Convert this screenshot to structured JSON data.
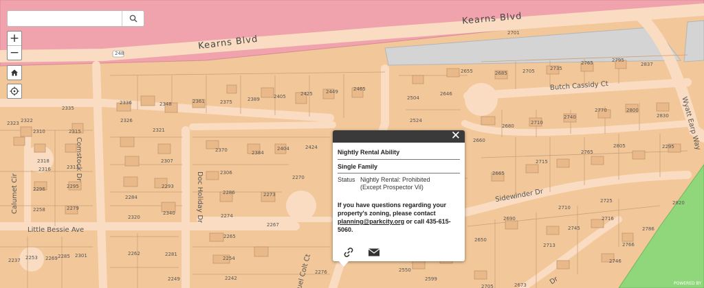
{
  "search": {
    "value": "",
    "placeholder": ""
  },
  "controls": {
    "zoom_in": "+",
    "zoom_out": "−"
  },
  "icons": {
    "search": "search-icon",
    "home": "home-icon",
    "locate": "locate-icon",
    "close": "close-icon",
    "link": "link-icon",
    "email": "envelope-icon"
  },
  "colors": {
    "residential": "#f2c79a",
    "commercial_pink": "#f0a3ad",
    "road": "#f9dcc2",
    "parking_gray": "#d4d4d4",
    "open_space_green": "#8fd77a"
  },
  "streets": {
    "kearns_west": "Kearns Blvd",
    "kearns_east": "Kearns Blvd",
    "comstock": "Comstock Dr",
    "doc_holiday": "Doc Holiday Dr",
    "calumet": "Calumet Cir",
    "little_bessie": "Little Bessie Ave",
    "butch_cassidy": "Butch Cassidy Ct",
    "wyatt_earp": "Wyatt Earp Way",
    "sidewinder": "Sidewinder Dr",
    "sidewinder_dr": "Dr",
    "samuel_colt": "uel Colt Ct",
    "route": "248"
  },
  "parcels": [
    {
      "id": "p1",
      "label": "2701"
    },
    {
      "id": "p2",
      "label": "2655"
    },
    {
      "id": "p3",
      "label": "2685"
    },
    {
      "id": "p4",
      "label": "2705"
    },
    {
      "id": "p5",
      "label": "2735"
    },
    {
      "id": "p6",
      "label": "2765"
    },
    {
      "id": "p7",
      "label": "2795"
    },
    {
      "id": "p8",
      "label": "2837"
    },
    {
      "id": "p9",
      "label": "2336"
    },
    {
      "id": "p10",
      "label": "2348"
    },
    {
      "id": "p11",
      "label": "2361"
    },
    {
      "id": "p12",
      "label": "2375"
    },
    {
      "id": "p13",
      "label": "2389"
    },
    {
      "id": "p14",
      "label": "2405"
    },
    {
      "id": "p15",
      "label": "2425"
    },
    {
      "id": "p16",
      "label": "2449"
    },
    {
      "id": "p17",
      "label": "2465"
    },
    {
      "id": "p18",
      "label": "2335"
    },
    {
      "id": "p19",
      "label": "2323"
    },
    {
      "id": "p20",
      "label": "2322"
    },
    {
      "id": "p21",
      "label": "2326"
    },
    {
      "id": "p22",
      "label": "2310"
    },
    {
      "id": "p23",
      "label": "2321"
    },
    {
      "id": "p24",
      "label": "2315"
    },
    {
      "id": "p25",
      "label": "2318"
    },
    {
      "id": "p26",
      "label": "2316"
    },
    {
      "id": "p27",
      "label": "2313"
    },
    {
      "id": "p28",
      "label": "2307"
    },
    {
      "id": "p29",
      "label": "2296"
    },
    {
      "id": "p30",
      "label": "2295"
    },
    {
      "id": "p31",
      "label": "2284"
    },
    {
      "id": "p32",
      "label": "2293"
    },
    {
      "id": "p33",
      "label": "2258"
    },
    {
      "id": "p34",
      "label": "2279"
    },
    {
      "id": "p35",
      "label": "2320"
    },
    {
      "id": "p36",
      "label": "2340"
    },
    {
      "id": "p37",
      "label": "2370"
    },
    {
      "id": "p38",
      "label": "2384"
    },
    {
      "id": "p39",
      "label": "2404"
    },
    {
      "id": "p40",
      "label": "2424"
    },
    {
      "id": "p41",
      "label": "2306"
    },
    {
      "id": "p42",
      "label": "2286"
    },
    {
      "id": "p43",
      "label": "2270"
    },
    {
      "id": "p44",
      "label": "2273"
    },
    {
      "id": "p45",
      "label": "2274"
    },
    {
      "id": "p46",
      "label": "2267"
    },
    {
      "id": "p47",
      "label": "2265"
    },
    {
      "id": "p48",
      "label": "2254"
    },
    {
      "id": "p49",
      "label": "2242"
    },
    {
      "id": "p50",
      "label": "2262"
    },
    {
      "id": "p51",
      "label": "2281"
    },
    {
      "id": "p52",
      "label": "2249"
    },
    {
      "id": "p53",
      "label": "2237"
    },
    {
      "id": "p54",
      "label": "2253"
    },
    {
      "id": "p55",
      "label": "2285"
    },
    {
      "id": "p56",
      "label": "2301"
    },
    {
      "id": "p57",
      "label": "2269"
    },
    {
      "id": "p58",
      "label": "2276"
    },
    {
      "id": "p59",
      "label": "2550"
    },
    {
      "id": "p60",
      "label": "2599"
    },
    {
      "id": "p61",
      "label": "2646"
    },
    {
      "id": "p62",
      "label": "2504"
    },
    {
      "id": "p63",
      "label": "2524"
    },
    {
      "id": "p64",
      "label": "2660"
    },
    {
      "id": "p65",
      "label": "2680"
    },
    {
      "id": "p66",
      "label": "2710"
    },
    {
      "id": "p67",
      "label": "2740"
    },
    {
      "id": "p68",
      "label": "2770"
    },
    {
      "id": "p69",
      "label": "2800"
    },
    {
      "id": "p70",
      "label": "2830"
    },
    {
      "id": "p71",
      "label": "2765"
    },
    {
      "id": "p72",
      "label": "2805"
    },
    {
      "id": "p73",
      "label": "2295"
    },
    {
      "id": "p74",
      "label": "2665"
    },
    {
      "id": "p75",
      "label": "2715"
    },
    {
      "id": "p76",
      "label": "2725"
    },
    {
      "id": "p77",
      "label": "2650"
    },
    {
      "id": "p78",
      "label": "2690"
    },
    {
      "id": "p79",
      "label": "2710"
    },
    {
      "id": "p80",
      "label": "2745"
    },
    {
      "id": "p81",
      "label": "2716"
    },
    {
      "id": "p82",
      "label": "2786"
    },
    {
      "id": "p83",
      "label": "2820"
    },
    {
      "id": "p84",
      "label": "2766"
    },
    {
      "id": "p85",
      "label": "2713"
    },
    {
      "id": "p86",
      "label": "2746"
    },
    {
      "id": "p87",
      "label": "2673"
    },
    {
      "id": "p88",
      "label": "2705"
    }
  ],
  "popup": {
    "close": "✕",
    "title": "Nightly Rental Ability",
    "subtitle": "Single Family",
    "field_key": "Status",
    "field_value_line1": "Nightly Rental: Prohibited",
    "field_value_line2": "(Except Prospector Vil)",
    "note_before": "If you have questions regarding your property's zoning, please contact ",
    "note_email": "planning@parkcity.org",
    "note_after": " or call 435-615-5060."
  },
  "attribution": "POWERED BY"
}
